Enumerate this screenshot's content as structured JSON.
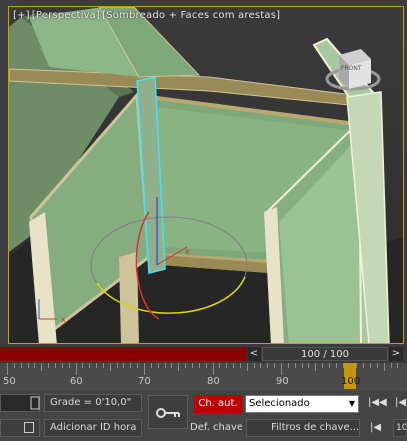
{
  "viewport": {
    "label_plus": "[+]",
    "label_view": "[Perspectiva]",
    "label_shading": "[Sombreado + Faces com arestas]",
    "viewcube_label": "FRONT"
  },
  "timeslider": {
    "prev_label": "<",
    "frame_text": "100 / 100",
    "next_label": ">"
  },
  "ruler": {
    "labels": [
      "50",
      "60",
      "70",
      "80",
      "90",
      "100"
    ]
  },
  "status": {
    "grid_text": "Grade = 0'10,0\"",
    "add_time_tag": "Adicionar ID hora",
    "auto_key": "Ch. aut.",
    "selection_mode": "Selecionado",
    "set_key": "Def. chave",
    "key_filters": "Filtros de chave...",
    "prev_key": "|◀◀",
    "prev_frame": "|◀",
    "frame_spin": "10"
  },
  "colors": {
    "viewport_border": "#c8a000",
    "glass": "#7fa87a",
    "frame_wood": "#9a8a55",
    "selection_cyan": "#40e0ff",
    "auto_key_red": "#c00000",
    "timeline_red": "#8b0000"
  }
}
